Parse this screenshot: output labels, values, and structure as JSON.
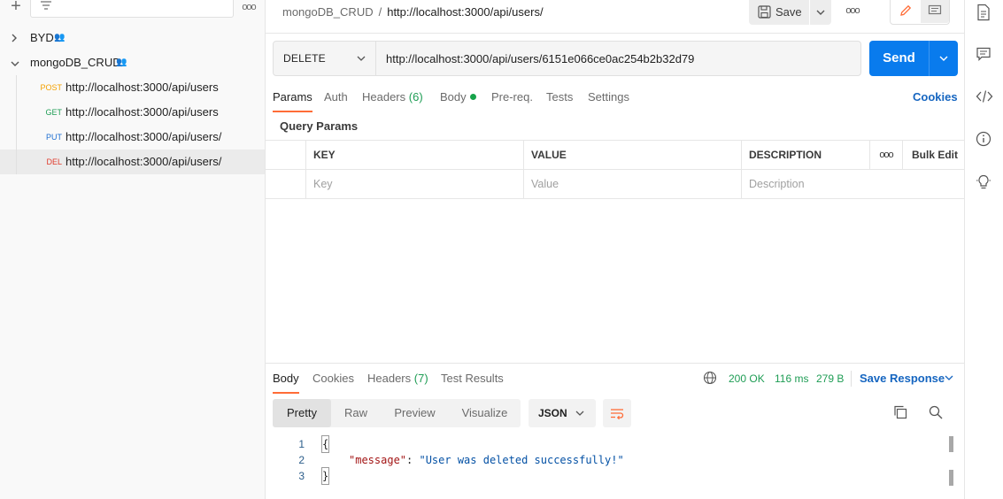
{
  "sidebar": {
    "new_icon": "plus-icon",
    "filter_icon": "filter-icon",
    "more_icon": "more-horizontal-icon",
    "collections": [
      {
        "name": "BYD",
        "expanded": false,
        "shared_icon": "people-icon"
      },
      {
        "name": "mongoDB_CRUD",
        "expanded": true,
        "shared_icon": "people-icon"
      }
    ],
    "requests": [
      {
        "method": "POST",
        "url": "http://localhost:3000/api/users"
      },
      {
        "method": "GET",
        "url": "http://localhost:3000/api/users"
      },
      {
        "method": "PUT",
        "url": "http://localhost:3000/api/users/"
      },
      {
        "method": "DEL",
        "url": "http://localhost:3000/api/users/",
        "selected": true
      }
    ]
  },
  "header": {
    "collection": "mongoDB_CRUD",
    "separator": "/",
    "request_name": "http://localhost:3000/api/users/",
    "save_label": "Save",
    "more_icon": "more-horizontal-icon"
  },
  "request": {
    "method": "DELETE",
    "url": "http://localhost:3000/api/users/6151e066ce0ac254b2b32d79",
    "send_label": "Send",
    "tabs": [
      {
        "label": "Params",
        "active": true
      },
      {
        "label": "Auth"
      },
      {
        "label": "Headers",
        "count": "(6)"
      },
      {
        "label": "Body",
        "dot": true
      },
      {
        "label": "Pre-req."
      },
      {
        "label": "Tests"
      },
      {
        "label": "Settings"
      }
    ],
    "cookies_label": "Cookies",
    "query_params_title": "Query Params",
    "table": {
      "headers": [
        "KEY",
        "VALUE",
        "DESCRIPTION"
      ],
      "more_icon": "more-horizontal-icon",
      "bulk_edit_label": "Bulk Edit",
      "placeholders": [
        "Key",
        "Value",
        "Description"
      ]
    }
  },
  "response": {
    "tabs": [
      {
        "label": "Body",
        "active": true
      },
      {
        "label": "Cookies"
      },
      {
        "label": "Headers",
        "count": "(7)"
      },
      {
        "label": "Test Results"
      }
    ],
    "status": "200 OK",
    "time": "116 ms",
    "size": "279 B",
    "save_response_label": "Save Response",
    "views": [
      "Pretty",
      "Raw",
      "Preview",
      "Visualize"
    ],
    "active_view": "Pretty",
    "format": "JSON",
    "lines": [
      {
        "n": "1",
        "text": "{"
      },
      {
        "n": "2",
        "key": "\"message\"",
        "value": "\"User was deleted successfully!\""
      },
      {
        "n": "3",
        "text": "}"
      }
    ]
  },
  "rail": {
    "icons": [
      "document-icon",
      "comment-icon",
      "code-icon",
      "info-icon",
      "lightbulb-icon"
    ]
  },
  "colors": {
    "accent_orange": "#ff6c37",
    "send_blue": "#097bed",
    "link_blue": "#1565c0",
    "status_green": "#1f9d55",
    "post": "#f4a100",
    "get": "#1f9d55",
    "put": "#1f6fd1",
    "delete": "#e03b2c"
  }
}
